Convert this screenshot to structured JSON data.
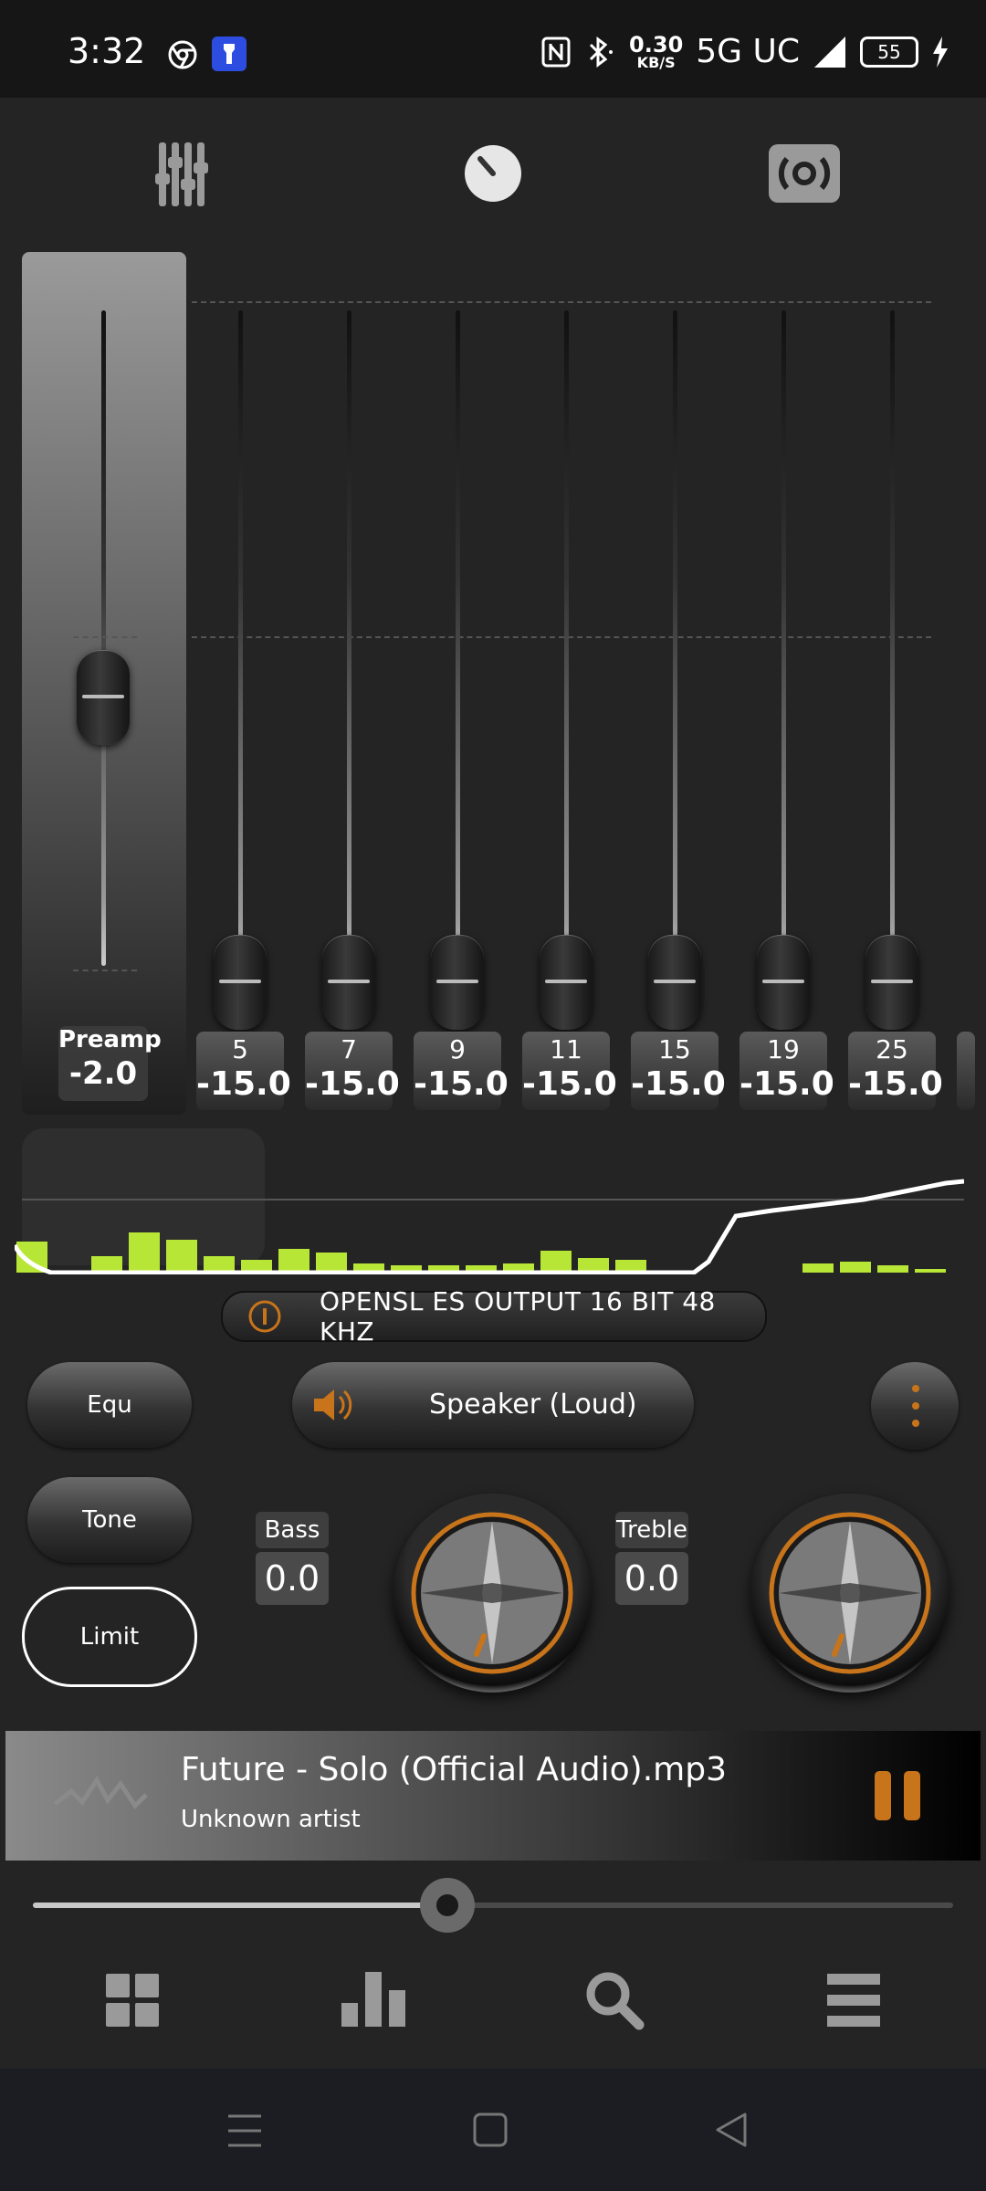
{
  "status_bar": {
    "time": "3:32",
    "net_speed_value": "0.30",
    "net_speed_unit": "KB/S",
    "network": "5G UC",
    "battery": "55"
  },
  "top_modes": {
    "icons": [
      "equalizer-sliders-icon",
      "tone-knob-icon",
      "surround-speaker-icon"
    ]
  },
  "preamp": {
    "label": "Preamp",
    "value": "-2.0",
    "level": 0.52
  },
  "bands": [
    {
      "freq": "5",
      "value": "-15.0"
    },
    {
      "freq": "7",
      "value": "-15.0"
    },
    {
      "freq": "9",
      "value": "-15.0"
    },
    {
      "freq": "11",
      "value": "-15.0"
    },
    {
      "freq": "15",
      "value": "-15.0"
    },
    {
      "freq": "19",
      "value": "-15.0"
    },
    {
      "freq": "25",
      "value": "-15.0"
    }
  ],
  "output_info": "OPENSL ES OUTPUT  16 BIT  48 KHZ",
  "buttons": {
    "equ": "Equ",
    "tone": "Tone",
    "limit": "Limit",
    "speaker": "Speaker (Loud)"
  },
  "tone": {
    "bass_label": "Bass",
    "bass_value": "0.0",
    "treble_label": "Treble",
    "treble_value": "0.0"
  },
  "now_playing": {
    "title": "Future - Solo (Official Audio).mp3",
    "artist": "Unknown artist",
    "progress": 0.45
  },
  "colors": {
    "accent_orange": "#c8741a",
    "spectrum_green": "#b8e636",
    "background": "#242424"
  },
  "bottom_nav": [
    "grid-icon",
    "bar-chart-icon",
    "search-icon",
    "menu-icon"
  ],
  "system_nav": [
    "recents-icon",
    "home-icon",
    "back-icon"
  ]
}
